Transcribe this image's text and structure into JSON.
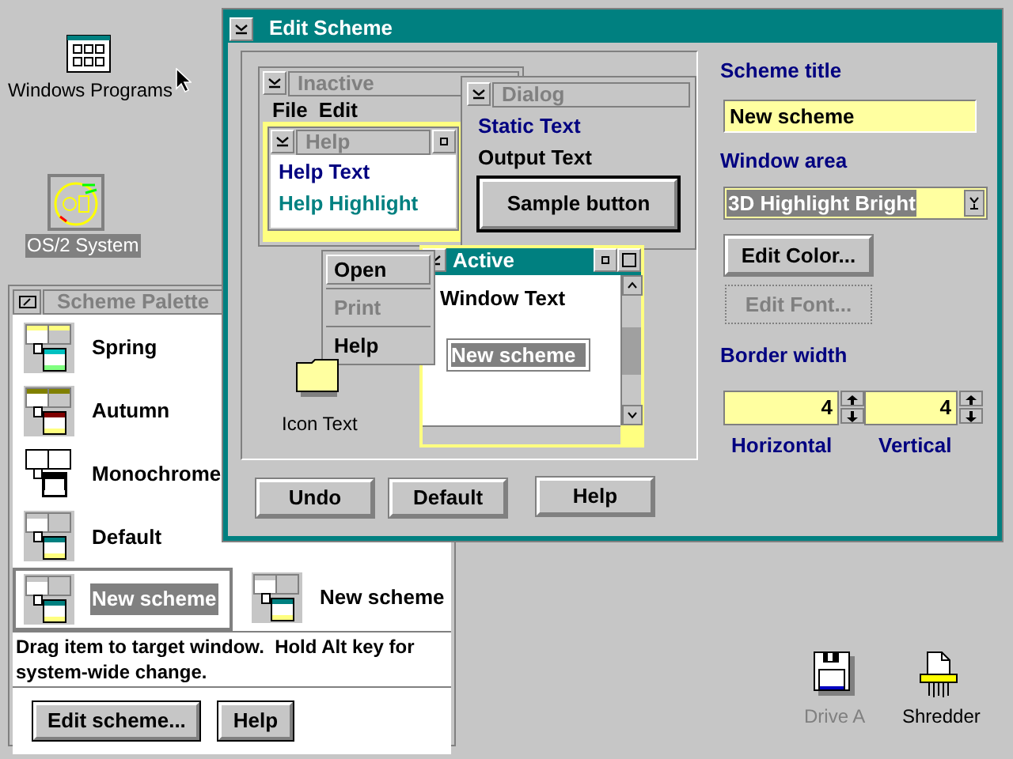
{
  "desktop_icons": [
    {
      "label": "Windows Programs",
      "kind": "program-group",
      "selected": false,
      "disabled": false
    },
    {
      "label": "OS/2 System",
      "kind": "system",
      "selected": true,
      "disabled": false
    },
    {
      "label": "Drive A",
      "kind": "floppy",
      "selected": false,
      "disabled": true
    },
    {
      "label": "Shredder",
      "kind": "shredder",
      "selected": false,
      "disabled": false
    }
  ],
  "scheme_palette": {
    "title": "Scheme Palette",
    "left_column": [
      {
        "label": "Spring",
        "kind": "spring",
        "selected": false
      },
      {
        "label": "Autumn",
        "kind": "autumn",
        "selected": false
      },
      {
        "label": "Monochrome",
        "kind": "monochrome",
        "selected": false
      },
      {
        "label": "Default",
        "kind": "default",
        "selected": false
      },
      {
        "label": "New scheme",
        "kind": "default",
        "selected": true
      }
    ],
    "right_column": [
      {
        "label": "New scheme",
        "kind": "default",
        "selected": false
      }
    ],
    "status_text": "Drag item to target window.  Hold Alt key for system-wide change.",
    "buttons": [
      "Edit scheme...",
      "Help"
    ]
  },
  "edit_scheme": {
    "title": "Edit Scheme",
    "preview": {
      "inactive_window": {
        "title": "Inactive",
        "menu": [
          "File",
          "Edit"
        ]
      },
      "help_window": {
        "title": "Help",
        "help_text": "Help Text",
        "help_highlight": "Help Highlight"
      },
      "dialog": {
        "title": "Dialog",
        "static_text": "Static Text",
        "output_text": "Output Text",
        "button": "Sample button"
      },
      "active_window": {
        "title": "Active",
        "window_text": "Window Text",
        "field_value": "New scheme"
      },
      "context_menu": [
        {
          "label": "Open",
          "selected": true,
          "disabled": false
        },
        {
          "label": "Print",
          "selected": false,
          "disabled": true
        },
        {
          "label": "Help",
          "selected": false,
          "disabled": false
        }
      ],
      "icon_label": "Icon Text"
    },
    "scheme_title": {
      "label": "Scheme title",
      "value": "New scheme"
    },
    "window_area": {
      "label": "Window area",
      "value": "3D Highlight Bright"
    },
    "side_buttons": [
      {
        "label": "Edit Color...",
        "disabled": false
      },
      {
        "label": "Edit Font...",
        "disabled": true
      }
    ],
    "border_width": {
      "label": "Border width",
      "horizontal": {
        "value": "4",
        "label": "Horizontal"
      },
      "vertical": {
        "value": "4",
        "label": "Vertical"
      }
    },
    "buttons": [
      "Undo",
      "Default",
      "Help"
    ]
  }
}
